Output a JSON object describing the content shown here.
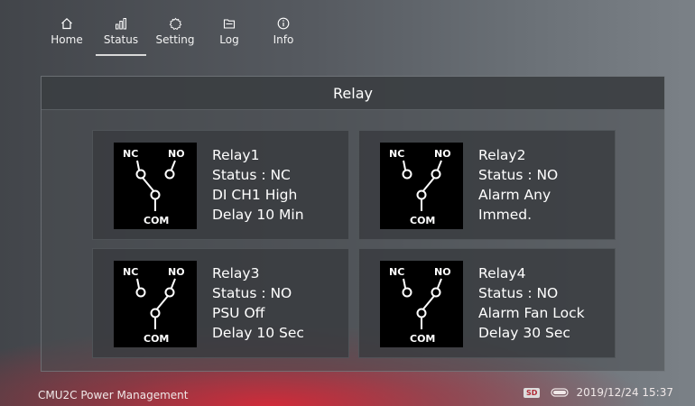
{
  "nav": {
    "tabs": [
      {
        "label": "Home",
        "icon": "home-icon"
      },
      {
        "label": "Status",
        "icon": "bar-chart-icon"
      },
      {
        "label": "Setting",
        "icon": "gear-icon"
      },
      {
        "label": "Log",
        "icon": "folder-icon"
      },
      {
        "label": "Info",
        "icon": "info-icon"
      }
    ],
    "active": "Status"
  },
  "panel": {
    "title": "Relay"
  },
  "diagram_labels": {
    "nc": "NC",
    "no": "NO",
    "com": "COM"
  },
  "relays": [
    {
      "name": "Relay1",
      "status": "Status : NC",
      "trigger": "DI CH1 High",
      "delay": "Delay 10 Min",
      "contact": "NC"
    },
    {
      "name": "Relay2",
      "status": "Status : NO",
      "trigger": "Alarm Any",
      "delay": "Immed.",
      "contact": "NO"
    },
    {
      "name": "Relay3",
      "status": "Status : NO",
      "trigger": "PSU Off",
      "delay": "Delay 10 Sec",
      "contact": "NO"
    },
    {
      "name": "Relay4",
      "status": "Status : NO",
      "trigger": "Alarm Fan Lock",
      "delay": "Delay 30 Sec",
      "contact": "NO"
    }
  ],
  "footer": {
    "app_name": "CMU2C Power Management",
    "sd_label": "SD",
    "datetime": "2019/12/24 15:37"
  },
  "colors": {
    "accent_red": "#d72837",
    "panel_bg": "#484c50"
  }
}
